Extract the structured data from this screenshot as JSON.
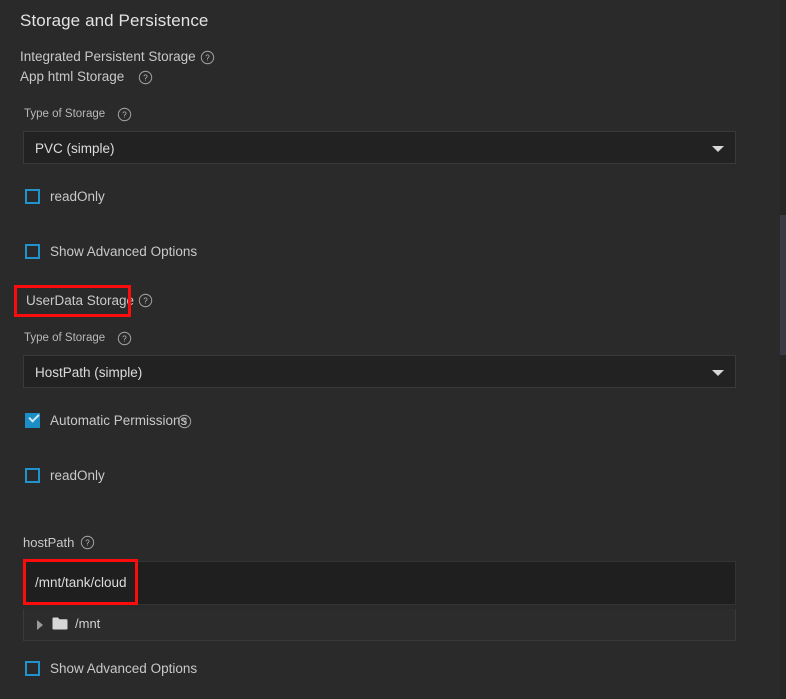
{
  "section": {
    "title": "Storage and Persistence"
  },
  "groups": [
    {
      "name": "integrated_persistent_storage",
      "label": "Integrated Persistent Storage",
      "help_icon": "help-circle-icon"
    },
    {
      "name": "app_html_storage",
      "label": "App html Storage",
      "help_icon": "help-circle-icon"
    }
  ],
  "app_html_storage": {
    "type_of_storage": {
      "label": "Type of Storage",
      "help_icon": "help-circle-icon",
      "selected": "PVC (simple)",
      "arrow_icon": "chevron-down-icon"
    },
    "read_only": {
      "label": "readOnly",
      "checked": false
    },
    "show_advanced_options": {
      "label": "Show Advanced Options",
      "checked": false
    }
  },
  "userdata_storage": {
    "label": "UserData Storage",
    "help_icon": "help-circle-icon",
    "highlighted": true,
    "type_of_storage": {
      "label": "Type of Storage",
      "help_icon": "help-circle-icon",
      "selected": "HostPath (simple)",
      "arrow_icon": "chevron-down-icon"
    },
    "automatic_permissions": {
      "label": "Automatic Permissions",
      "help_icon": "help-circle-icon",
      "checked": true
    },
    "read_only": {
      "label": "readOnly",
      "checked": false
    },
    "host_path": {
      "label": "hostPath",
      "help_icon": "help-circle-icon",
      "value": "/mnt/tank/cloud",
      "highlighted": true,
      "tree": [
        {
          "label": "/mnt",
          "expander_icon": "caret-right-icon",
          "folder_icon": "folder-icon",
          "expanded": false
        }
      ]
    },
    "show_advanced_options": {
      "label": "Show Advanced Options",
      "checked": false
    }
  },
  "colors": {
    "background": "#2a2a2a",
    "field_background": "#222222",
    "accent_blue": "#1b8ec6",
    "annotation_red": "#fb0d0d",
    "text_primary": "#d6d6d6"
  }
}
